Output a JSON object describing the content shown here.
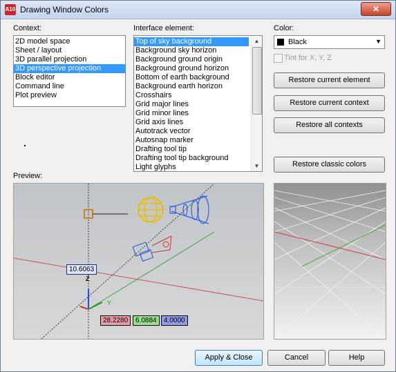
{
  "window": {
    "title": "Drawing Window Colors",
    "app_icon_text": "A10",
    "close_glyph": "✕"
  },
  "context": {
    "label": "Context:",
    "items": [
      "2D model space",
      "Sheet / layout",
      "3D parallel projection",
      "3D perspective projection",
      "Block editor",
      "Command line",
      "Plot preview"
    ],
    "selected_index": 3
  },
  "interface_element": {
    "label": "Interface element:",
    "items": [
      "Top of sky background",
      "Background sky horizon",
      "Background ground origin",
      "Background ground horizon",
      "Bottom of earth background",
      "Background earth horizon",
      "Crosshairs",
      "Grid major lines",
      "Grid minor lines",
      "Grid axis lines",
      "Autotrack vector",
      "Autosnap marker",
      "Drafting tool tip",
      "Drafting tool tip background",
      "Light glyphs"
    ],
    "selected_index": 0
  },
  "color": {
    "label": "Color:",
    "selected": "Black",
    "swatch_color": "#000000",
    "tint_label": "Tint for X, Y, Z"
  },
  "buttons": {
    "restore_current_element": "Restore current element",
    "restore_current_context": "Restore current context",
    "restore_all_contexts": "Restore all contexts",
    "restore_classic_colors": "Restore classic colors",
    "apply_close": "Apply & Close",
    "cancel": "Cancel",
    "help": "Help"
  },
  "preview": {
    "label": "Preview:",
    "dim_value": "10.6063",
    "z_label": "Z",
    "y_label": "Y",
    "coord_x": "28.2280",
    "coord_y": "6.0884",
    "coord_z": "4.0000"
  }
}
